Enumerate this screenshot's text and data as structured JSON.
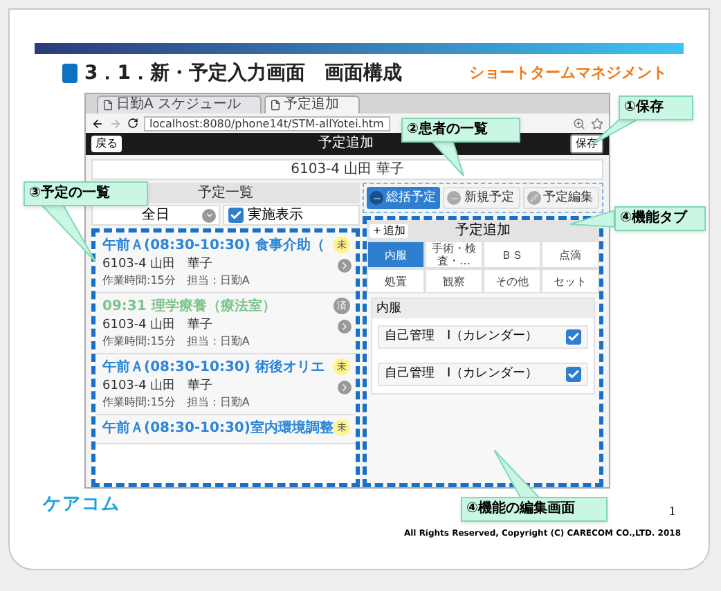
{
  "slide": {
    "title": "3．1．新・予定入力画面　画面構成",
    "product": "ショートタームマネジメント",
    "logo": "ケアコム",
    "page_number": "1",
    "copyright": "All Rights Reserved, Copyright (C) CARECOM CO.,LTD. 2018"
  },
  "browser": {
    "tabs": [
      {
        "label": "日勤A スケジュール",
        "selected": false
      },
      {
        "label": "予定追加",
        "selected": true
      }
    ],
    "address": "localhost:8080/phone14t/STM-allYotei.htm"
  },
  "app": {
    "back": "戻る",
    "title": "予定追加",
    "save": "保存",
    "patient": "6103-4 山田 華子",
    "list": {
      "title": "予定一覧",
      "filter": "全日",
      "show_done": {
        "label": "実施表示",
        "checked": true
      },
      "items": [
        {
          "title": "午前Ａ(08:30-10:30) 食事介助（",
          "patient": "6103-4 山田　華子",
          "meta": "作業時間:15分　担当：日勤A",
          "badge": "未",
          "done": false
        },
        {
          "title": "09:31 理学療養（療法室）",
          "patient": "6103-4 山田　華子",
          "meta": "作業時間:15分　担当：日勤A",
          "badge": "済",
          "done": true
        },
        {
          "title": "午前Ａ(08:30-10:30) 術後オリエ",
          "patient": "6103-4 山田　華子",
          "meta": "作業時間:15分　担当：日勤A",
          "badge": "未",
          "done": false
        },
        {
          "title": "午前Ａ(08:30-10:30)室内環境調整",
          "badge": "未",
          "done": false
        }
      ]
    },
    "function_tabs": [
      {
        "label": "総括予定",
        "selected": true
      },
      {
        "label": "新規予定",
        "selected": false
      },
      {
        "label": "予定編集",
        "selected": false
      }
    ],
    "editor": {
      "add": "追加",
      "title": "予定追加",
      "categories": [
        {
          "label": "内服",
          "selected": true
        },
        {
          "label": "手術・検査・…",
          "selected": false
        },
        {
          "label": "ＢＳ",
          "selected": false
        },
        {
          "label": "点滴",
          "selected": false
        },
        {
          "label": "処置",
          "selected": false
        },
        {
          "label": "観察",
          "selected": false
        },
        {
          "label": "その他",
          "selected": false
        },
        {
          "label": "セット",
          "selected": false
        }
      ],
      "section": "内服",
      "rows": [
        {
          "label": "自己管理　Ⅰ（カレンダー）",
          "checked": true
        },
        {
          "label": "自己管理　Ⅰ（カレンダー）",
          "checked": true
        }
      ]
    }
  },
  "callouts": [
    {
      "label": "①保存"
    },
    {
      "label": "②患者の一覧"
    },
    {
      "label": "③予定の一覧"
    },
    {
      "label": "④機能タブ"
    },
    {
      "label": "④機能の編集画面"
    }
  ]
}
